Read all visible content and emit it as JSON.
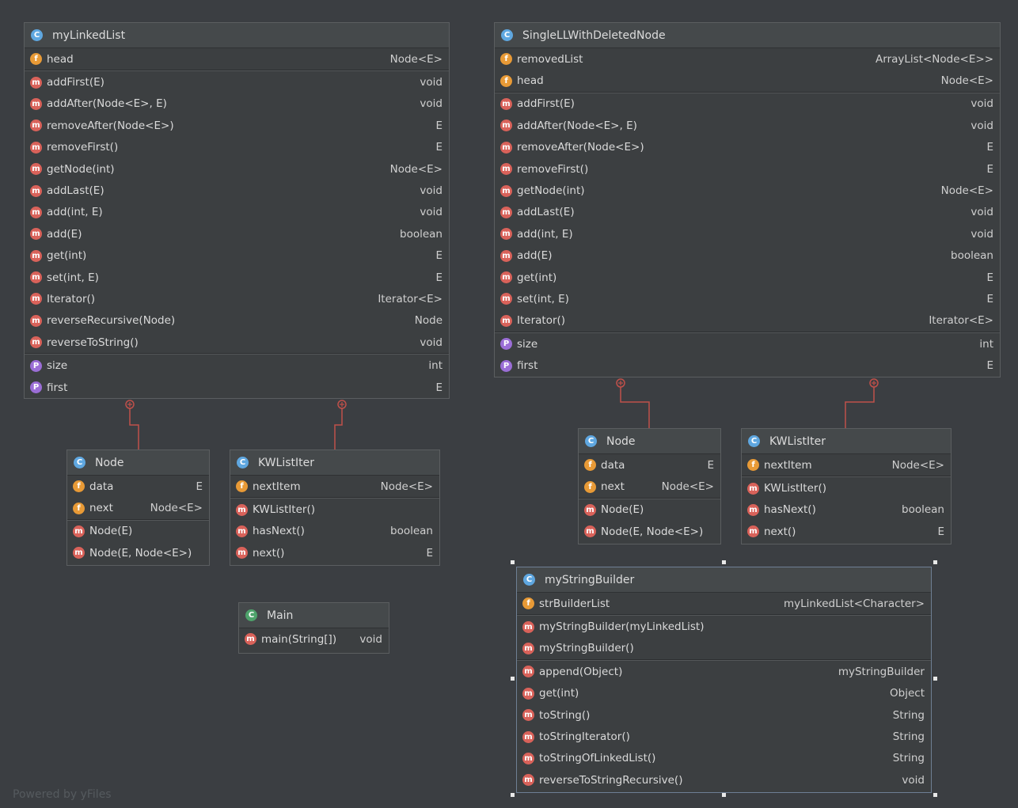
{
  "footer": "Powered by yFiles",
  "classes": {
    "myLinkedList": {
      "name": "myLinkedList",
      "fields": [
        {
          "name": "head",
          "type": "Node<E>"
        }
      ],
      "methods": [
        {
          "name": "addFirst(E)",
          "type": "void"
        },
        {
          "name": "addAfter(Node<E>, E)",
          "type": "void"
        },
        {
          "name": "removeAfter(Node<E>)",
          "type": "E"
        },
        {
          "name": "removeFirst()",
          "type": "E"
        },
        {
          "name": "getNode(int)",
          "type": "Node<E>"
        },
        {
          "name": "addLast(E)",
          "type": "void"
        },
        {
          "name": "add(int, E)",
          "type": "void"
        },
        {
          "name": "add(E)",
          "type": "boolean"
        },
        {
          "name": "get(int)",
          "type": "E"
        },
        {
          "name": "set(int, E)",
          "type": "E"
        },
        {
          "name": "Iterator()",
          "type": "Iterator<E>"
        },
        {
          "name": "reverseRecursive(Node)",
          "type": "Node"
        },
        {
          "name": "reverseToString()",
          "type": "void"
        }
      ],
      "properties": [
        {
          "name": "size",
          "type": "int"
        },
        {
          "name": "first",
          "type": "E"
        }
      ]
    },
    "node1": {
      "name": "Node",
      "fields": [
        {
          "name": "data",
          "type": "E"
        },
        {
          "name": "next",
          "type": "Node<E>"
        }
      ],
      "methods": [
        {
          "name": "Node(E)",
          "type": ""
        },
        {
          "name": "Node(E, Node<E>)",
          "type": ""
        }
      ]
    },
    "kwlistiter1": {
      "name": "KWListIter",
      "fields": [
        {
          "name": "nextItem",
          "type": "Node<E>"
        }
      ],
      "methods": [
        {
          "name": "KWListIter()",
          "type": ""
        },
        {
          "name": "hasNext()",
          "type": "boolean"
        },
        {
          "name": "next()",
          "type": "E"
        }
      ]
    },
    "main": {
      "name": "Main",
      "methods": [
        {
          "name": "main(String[])",
          "type": "void"
        }
      ]
    },
    "single": {
      "name": "SingleLLWithDeletedNode",
      "fields": [
        {
          "name": "removedList",
          "type": "ArrayList<Node<E>>"
        },
        {
          "name": "head",
          "type": "Node<E>"
        }
      ],
      "methods": [
        {
          "name": "addFirst(E)",
          "type": "void"
        },
        {
          "name": "addAfter(Node<E>, E)",
          "type": "void"
        },
        {
          "name": "removeAfter(Node<E>)",
          "type": "E"
        },
        {
          "name": "removeFirst()",
          "type": "E"
        },
        {
          "name": "getNode(int)",
          "type": "Node<E>"
        },
        {
          "name": "addLast(E)",
          "type": "void"
        },
        {
          "name": "add(int, E)",
          "type": "void"
        },
        {
          "name": "add(E)",
          "type": "boolean"
        },
        {
          "name": "get(int)",
          "type": "E"
        },
        {
          "name": "set(int, E)",
          "type": "E"
        },
        {
          "name": "Iterator()",
          "type": "Iterator<E>"
        }
      ],
      "properties": [
        {
          "name": "size",
          "type": "int"
        },
        {
          "name": "first",
          "type": "E"
        }
      ]
    },
    "node2": {
      "name": "Node",
      "fields": [
        {
          "name": "data",
          "type": "E"
        },
        {
          "name": "next",
          "type": "Node<E>"
        }
      ],
      "methods": [
        {
          "name": "Node(E)",
          "type": ""
        },
        {
          "name": "Node(E, Node<E>)",
          "type": ""
        }
      ]
    },
    "kwlistiter2": {
      "name": "KWListIter",
      "fields": [
        {
          "name": "nextItem",
          "type": "Node<E>"
        }
      ],
      "methods": [
        {
          "name": "KWListIter()",
          "type": ""
        },
        {
          "name": "hasNext()",
          "type": "boolean"
        },
        {
          "name": "next()",
          "type": "E"
        }
      ]
    },
    "sb": {
      "name": "myStringBuilder",
      "fields": [
        {
          "name": "strBuilderList",
          "type": "myLinkedList<Character>"
        }
      ],
      "constructors": [
        {
          "name": "myStringBuilder(myLinkedList)",
          "type": ""
        },
        {
          "name": "myStringBuilder()",
          "type": ""
        }
      ],
      "methods": [
        {
          "name": "append(Object)",
          "type": "myStringBuilder"
        },
        {
          "name": "get(int)",
          "type": "Object"
        },
        {
          "name": "toString()",
          "type": "String"
        },
        {
          "name": "toStringIterator()",
          "type": "String"
        },
        {
          "name": "toStringOfLinkedList()",
          "type": "String"
        },
        {
          "name": "reverseToStringRecursive()",
          "type": "void"
        }
      ]
    }
  },
  "icons": {
    "class": "C",
    "field": "f",
    "method": "m",
    "property": "P"
  }
}
